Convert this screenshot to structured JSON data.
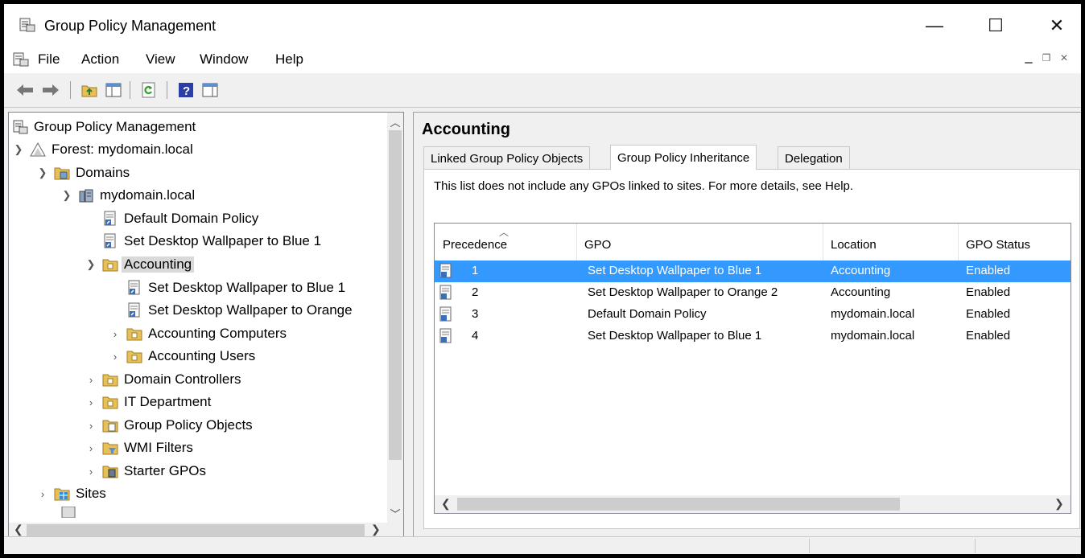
{
  "window": {
    "title": "Group Policy Management"
  },
  "menu": [
    "File",
    "Action",
    "View",
    "Window",
    "Help"
  ],
  "tree": {
    "root": "Group Policy Management",
    "forest": "Forest: mydomain.local",
    "domains": "Domains",
    "domain": "mydomain.local",
    "ddp": "Default Domain Policy",
    "wallpaper_blue": "Set Desktop Wallpaper to Blue 1",
    "accounting": "Accounting",
    "acc_blue": "Set Desktop Wallpaper to Blue 1",
    "acc_orange": "Set Desktop Wallpaper to Orange",
    "acc_computers": "Accounting Computers",
    "acc_users": "Accounting Users",
    "dc": "Domain Controllers",
    "it": "IT Department",
    "gpo_objects": "Group Policy Objects",
    "wmi": "WMI Filters",
    "starter": "Starter GPOs",
    "sites": "Sites"
  },
  "detail": {
    "title": "Accounting",
    "tabs": [
      "Linked Group Policy Objects",
      "Group Policy Inheritance",
      "Delegation"
    ],
    "active_tab": "Group Policy Inheritance",
    "note": "This list does not include any GPOs linked to sites. For more details, see Help.",
    "columns": [
      "Precedence",
      "GPO",
      "Location",
      "GPO Status"
    ],
    "rows": [
      {
        "precedence": "1",
        "gpo": "Set Desktop Wallpaper to Blue 1",
        "location": "Accounting",
        "status": "Enabled"
      },
      {
        "precedence": "2",
        "gpo": "Set Desktop Wallpaper to Orange 2",
        "location": "Accounting",
        "status": "Enabled"
      },
      {
        "precedence": "3",
        "gpo": "Default Domain Policy",
        "location": "mydomain.local",
        "status": "Enabled"
      },
      {
        "precedence": "4",
        "gpo": "Set Desktop Wallpaper to Blue 1",
        "location": "mydomain.local",
        "status": "Enabled"
      }
    ]
  },
  "colors": {
    "selection": "#3399ff",
    "tree_selection": "#d9d9d9"
  }
}
